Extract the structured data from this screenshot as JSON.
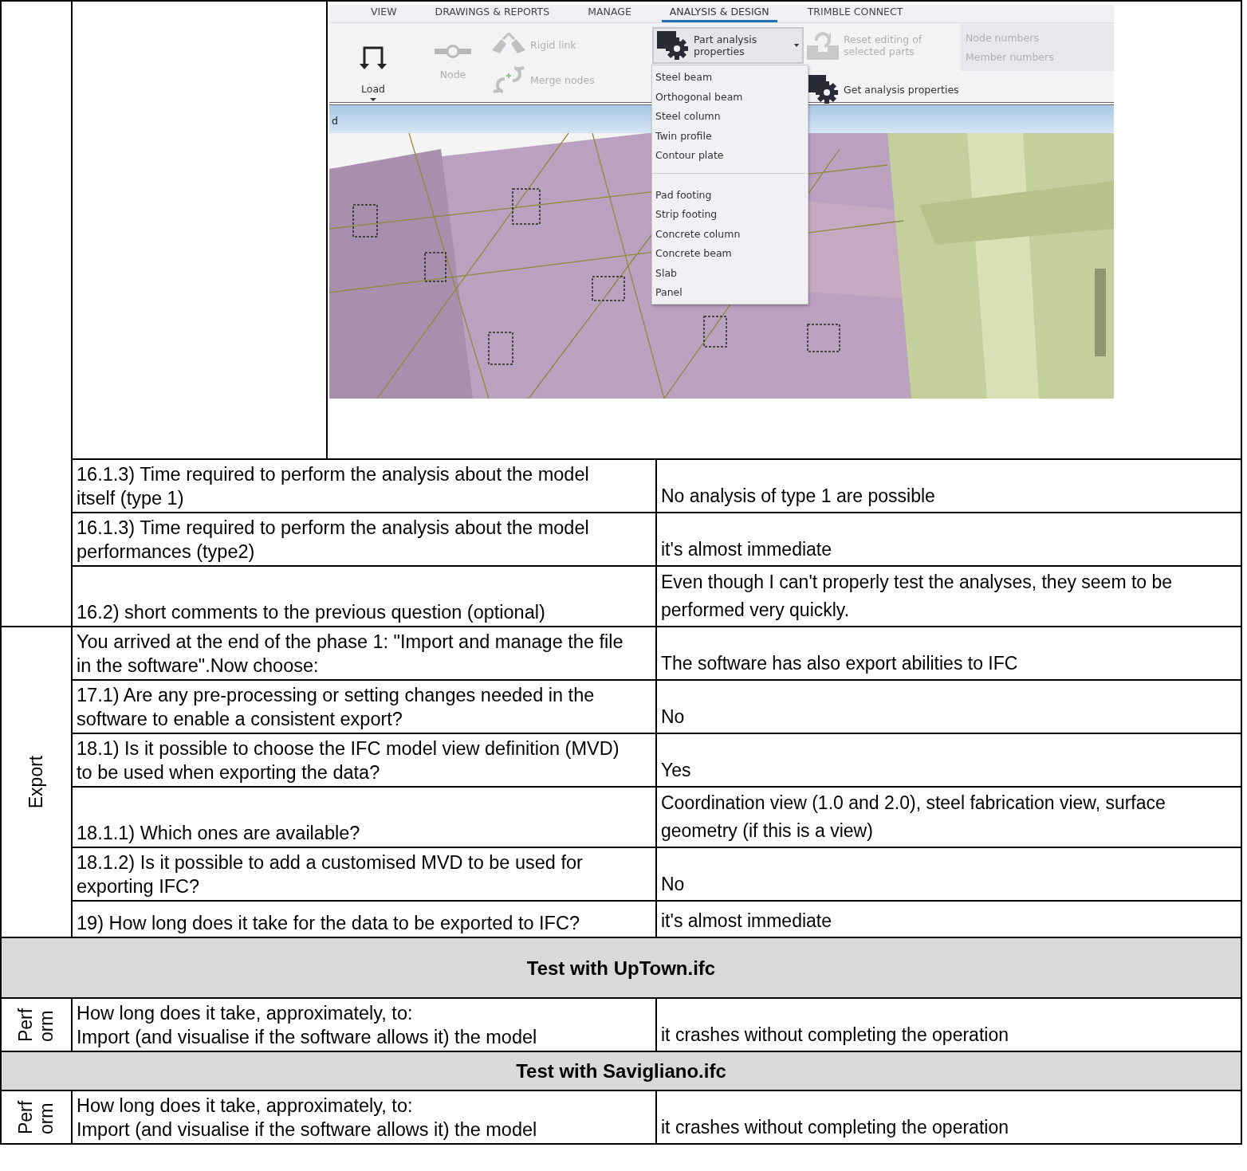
{
  "table": [
    {
      "kind": "group",
      "rows": [
        {
          "kind": "screenshot",
          "app": {
            "tabs": [
              {
                "label": "VIEW",
                "selected": false
              },
              {
                "label": "DRAWINGS & REPORTS",
                "selected": false
              },
              {
                "label": "MANAGE",
                "selected": false
              },
              {
                "label": "ANALYSIS & DESIGN",
                "selected": true
              },
              {
                "label": "TRIMBLE CONNECT",
                "selected": false
              }
            ],
            "ribbon": [
              {
                "kind": "stack",
                "items": [
                  {
                    "kind": "large",
                    "label": "Load",
                    "disabled": false,
                    "caret": true
                  }
                ]
              },
              {
                "kind": "stack",
                "items": [
                  {
                    "kind": "large",
                    "label": "Node",
                    "disabled": true,
                    "caret": false
                  }
                ]
              },
              {
                "kind": "stack",
                "items": [
                  {
                    "kind": "small",
                    "label": "Rigid link",
                    "disabled": true
                  },
                  {
                    "kind": "small",
                    "label": "Merge nodes",
                    "disabled": true
                  }
                ]
              },
              {
                "kind": "stack",
                "items": [
                  {
                    "kind": "split",
                    "label": "Part analysis properties",
                    "disabled": false,
                    "expanded": true,
                    "menu": [
                      {
                        "items": [
                          "Steel beam",
                          "Orthogonal beam",
                          "Steel column",
                          "Twin profile",
                          "Contour plate"
                        ]
                      },
                      {
                        "items": [
                          "Pad footing",
                          "Strip footing",
                          "Concrete column",
                          "Concrete beam",
                          "Slab",
                          "Panel"
                        ]
                      }
                    ]
                  }
                ]
              },
              {
                "kind": "stack",
                "items": [
                  {
                    "kind": "medium",
                    "label": "Reset editing of selected parts",
                    "disabled": true
                  },
                  {
                    "kind": "medium",
                    "label": "Get analysis properties",
                    "disabled": false
                  }
                ]
              },
              {
                "kind": "panel",
                "items": [
                  {
                    "kind": "plain",
                    "label": "Node numbers",
                    "disabled": true
                  },
                  {
                    "kind": "plain",
                    "label": "Member numbers",
                    "disabled": true
                  }
                ]
              }
            ],
            "viewport": {
              "title": "d",
              "kind": "picture"
            }
          }
        },
        {
          "kind": "qa",
          "question": "16.1.3) Time required to perform the analysis about the model itself (type 1)",
          "answer": "No analysis of type 1 are possible"
        },
        {
          "kind": "qa",
          "question": "16.1.3) Time required to perform the analysis about the model performances (type2)",
          "answer": "it's almost immediate"
        },
        {
          "kind": "qa",
          "question": "16.2) short comments to the previous question (optional)",
          "answer": "Even though I can't properly test the analyses, they seem to be performed very quickly."
        }
      ]
    },
    {
      "kind": "group",
      "label_lines": [
        "Export"
      ],
      "rows": [
        {
          "kind": "qa",
          "question": "You arrived at the end of the phase 1: \"Import and manage the file in the software\".Now choose:",
          "answer": "The software has also export abilities to IFC"
        },
        {
          "kind": "qa",
          "question": "17.1) Are any pre-processing or setting changes needed in the software to enable a consistent export?",
          "answer": "No"
        },
        {
          "kind": "qa",
          "question": "18.1) Is it possible to choose the IFC model view definition (MVD) to be used when exporting the data?",
          "answer": "Yes"
        },
        {
          "kind": "qa",
          "question": "18.1.1) Which ones are available?",
          "answer": "Coordination view (1.0 and 2.0), steel fabrication view, surface geometry (if this is a view)"
        },
        {
          "kind": "qa",
          "question": "18.1.2) Is it possible to add a customised MVD to be used for exporting IFC?",
          "answer": "No"
        },
        {
          "kind": "qa",
          "question": "19) How long does it take for the data to be exported to IFC?",
          "answer": "it's almost immediate"
        }
      ]
    },
    {
      "kind": "heading",
      "text": "Test with UpTown.ifc"
    },
    {
      "kind": "group",
      "label_lines": [
        "Perf",
        "orm"
      ],
      "rows": [
        {
          "kind": "qa",
          "question_lines": [
            "How long does it take, approximately, to:",
            "Import (and visualise if the software allows it) the model"
          ],
          "answer": "it crashes without completing the operation"
        }
      ]
    },
    {
      "kind": "heading",
      "text": "Test with Savigliano.ifc"
    },
    {
      "kind": "group",
      "label_lines": [
        "Perf",
        "orm"
      ],
      "rows": [
        {
          "kind": "qa",
          "question_lines": [
            "How long does it take, approximately, to:",
            "Import (and visualise if the software allows it) the model"
          ],
          "answer": "it crashes without completing the operation"
        }
      ]
    }
  ]
}
